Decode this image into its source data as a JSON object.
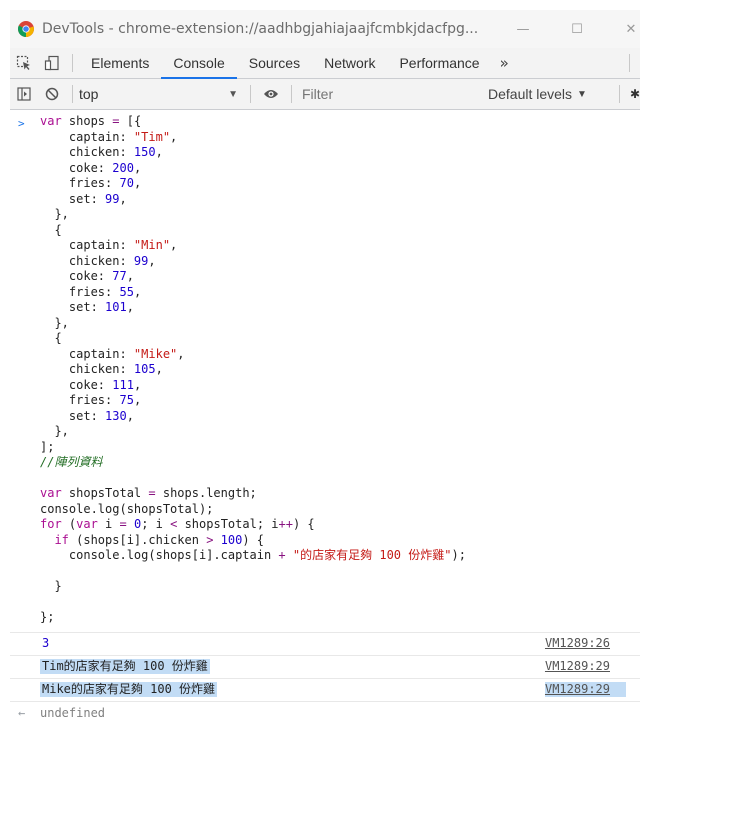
{
  "window": {
    "title": "DevTools - chrome-extension://aadhbgjahiajaajfcmbkjdacfpg...",
    "minimize": "—",
    "maximize": "☐",
    "close": "✕"
  },
  "tabs": [
    {
      "label": "Elements"
    },
    {
      "label": "Console"
    },
    {
      "label": "Sources"
    },
    {
      "label": "Network"
    },
    {
      "label": "Performance"
    }
  ],
  "tab_overflow": "»",
  "console_toolbar": {
    "context": "top",
    "filter_placeholder": "Filter",
    "levels": "Default levels"
  },
  "console": {
    "prompt": ">",
    "input_lines": [
      "var shops = [{",
      "    captain: \"Tim\",",
      "    chicken: 150,",
      "    coke: 200,",
      "    fries: 70,",
      "    set: 99,",
      "  },",
      "  {",
      "    captain: \"Min\",",
      "    chicken: 99,",
      "    coke: 77,",
      "    fries: 55,",
      "    set: 101,",
      "  },",
      "  {",
      "    captain: \"Mike\",",
      "    chicken: 105,",
      "    coke: 111,",
      "    fries: 75,",
      "    set: 130,",
      "  },",
      "];",
      "//陣列資料",
      "",
      "var shopsTotal = shops.length;",
      "console.log(shopsTotal);",
      "for (var i = 0; i < shopsTotal; i++) {",
      "  if (shops[i].chicken > 100) {",
      "    console.log(shops[i].captain + \"的店家有足夠 100 份炸雞\");",
      "",
      "  }",
      "",
      "};"
    ],
    "messages": [
      {
        "text": "3",
        "source": "VM1289:26"
      },
      {
        "text": "Tim的店家有足夠 100 份炸雞",
        "source": "VM1289:29"
      },
      {
        "text": "Mike的店家有足夠 100 份炸雞",
        "source": "VM1289:29"
      }
    ],
    "result_arrow": "←",
    "result": "undefined"
  },
  "colors": {
    "accent": "#1a73e8",
    "keyword": "#aa0d91",
    "string": "#c41a16",
    "number": "#1c00cf",
    "comment": "#236e25",
    "selection": "#c2dcf5"
  }
}
